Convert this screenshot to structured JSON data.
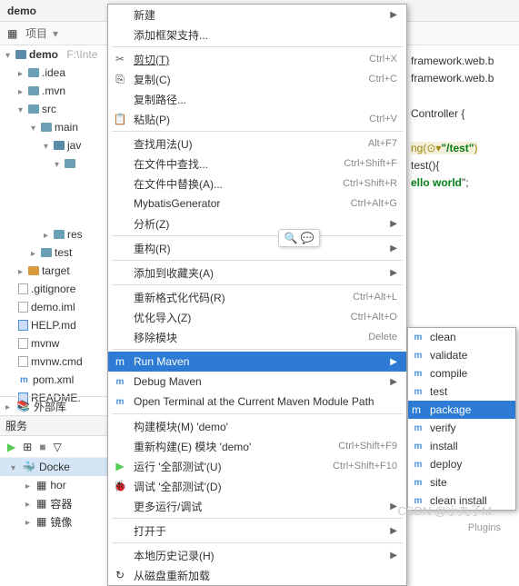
{
  "breadcrumb": "demo",
  "toolbar": {
    "project_label": "项目"
  },
  "tree": {
    "root": "demo",
    "root_hint": "F:\\Inte",
    "idea": ".idea",
    "mvn": ".mvn",
    "src": "src",
    "main": "main",
    "java": "jav",
    "res": "res",
    "test": "test",
    "target": "target",
    "gitignore": ".gitignore",
    "demoiml": "demo.iml",
    "help": "HELP.md",
    "mvnw": "mvnw",
    "mvnwcmd": "mvnw.cmd",
    "pom": "pom.xml",
    "readme": "README."
  },
  "extlib": "外部库",
  "services": {
    "title": "服务",
    "docker": "Docke",
    "hor": "hor",
    "rongqi": "容器",
    "jingxiang": "镜像"
  },
  "ctx": {
    "new": "新建",
    "addframework": "添加框架支持...",
    "cut": "剪切(T)",
    "cut_k": "Ctrl+X",
    "copy": "复制(C)",
    "copy_k": "Ctrl+C",
    "copypath": "复制路径...",
    "paste": "粘贴(P)",
    "paste_k": "Ctrl+V",
    "findusages": "查找用法(U)",
    "findusages_k": "Alt+F7",
    "findinfiles": "在文件中查找...",
    "findinfiles_k": "Ctrl+Shift+F",
    "replaceinfiles": "在文件中替换(A)...",
    "replaceinfiles_k": "Ctrl+Shift+R",
    "mybatis": "MybatisGenerator",
    "mybatis_k": "Ctrl+Alt+G",
    "analyze": "分析(Z)",
    "refactor": "重构(R)",
    "addfav": "添加到收藏夹(A)",
    "reformat": "重新格式化代码(R)",
    "reformat_k": "Ctrl+Alt+L",
    "optimize": "优化导入(Z)",
    "optimize_k": "Ctrl+Alt+O",
    "remove": "移除模块",
    "remove_k": "Delete",
    "runmaven": "Run Maven",
    "debugmaven": "Debug Maven",
    "openterminal": "Open Terminal at the Current Maven Module Path",
    "buildmodule": "构建模块(M) 'demo'",
    "rebuild": "重新构建(E) 模块 'demo'",
    "rebuild_k": "Ctrl+Shift+F9",
    "runall": "运行 '全部测试'(U)",
    "runall_k": "Ctrl+Shift+F10",
    "debugall": "调试 '全部测试'(D)",
    "morerun": "更多运行/调试",
    "openin": "打开于",
    "localhistory": "本地历史记录(H)",
    "reload": "从磁盘重新加载"
  },
  "submenu": {
    "clean": "clean",
    "validate": "validate",
    "compile": "compile",
    "test": "test",
    "package": "package",
    "verify": "verify",
    "install": "install",
    "deploy": "deploy",
    "site": "site",
    "cleaninstall": "clean install"
  },
  "editor": {
    "l1": "framework.web.b",
    "l2": "framework.web.b",
    "l3": "Controller {",
    "l4a": "ng(",
    "l4b": "\"/test\"",
    "l4c": ")",
    "l5": " test(){",
    "l6a": "ello world",
    "l6b": "\";"
  },
  "watermark": "CSDN @小丸子M",
  "plugins": "Plugins"
}
